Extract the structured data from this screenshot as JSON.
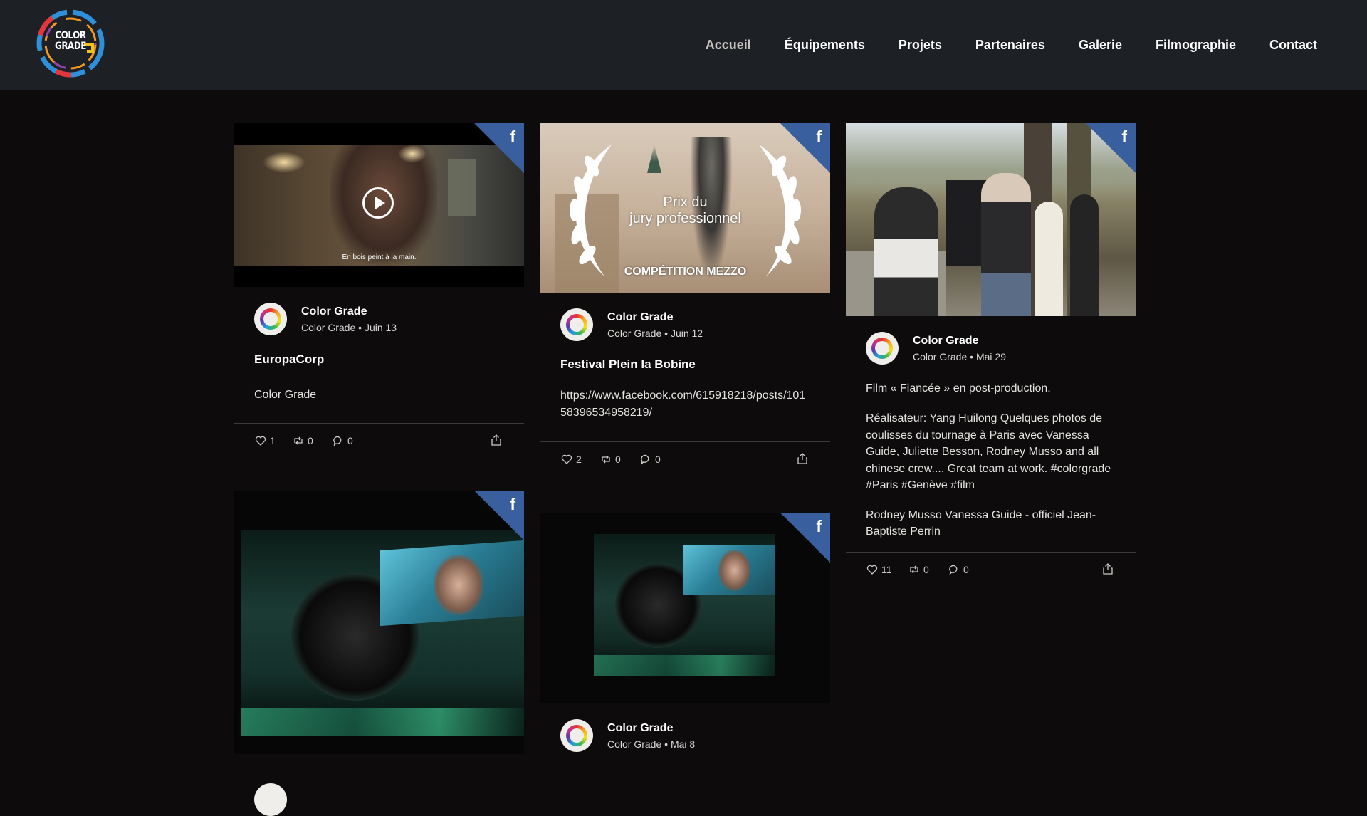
{
  "site": {
    "logo_text": "COLOR\nGRADE",
    "nav": [
      {
        "label": "Accueil",
        "active": true
      },
      {
        "label": "Équipements"
      },
      {
        "label": "Projets"
      },
      {
        "label": "Partenaires"
      },
      {
        "label": "Galerie"
      },
      {
        "label": "Filmographie"
      },
      {
        "label": "Contact"
      }
    ]
  },
  "posts": [
    {
      "source": "f",
      "media_caption": "En bois peint à la main.",
      "author": "Color Grade",
      "account": "Color Grade",
      "date": "Juin 13",
      "title": "EuropaCorp",
      "body": [
        "Color Grade"
      ],
      "likes": "1",
      "shares": "0",
      "comments": "0"
    },
    {
      "source": "f",
      "media_title_line1": "Prix du",
      "media_title_line2": "jury professionnel",
      "media_subtitle": "COMPÉTITION MEZZO",
      "author": "Color Grade",
      "account": "Color Grade",
      "date": "Juin 12",
      "title": "Festival Plein la Bobine",
      "body": [
        "https://www.facebook.com/615918218/posts/10158396534958219/"
      ],
      "likes": "2",
      "shares": "0",
      "comments": "0"
    },
    {
      "source": "f",
      "author": "Color Grade",
      "account": "Color Grade",
      "date": "Mai 29",
      "body": [
        "Film « Fiancée » en post-production.",
        "Réalisateur: Yang Huilong Quelques photos de coulisses du tournage à Paris avec Vanessa Guide, Juliette Besson, Rodney Musso and all chinese crew.... Great team at work. #colorgrade #Paris #Genève #film",
        "Rodney Musso Vanessa Guide - officiel Jean-Baptiste Perrin"
      ],
      "likes": "11",
      "shares": "0",
      "comments": "0"
    },
    {
      "source": "f"
    },
    {
      "source": "f",
      "author": "Color Grade",
      "account": "Color Grade",
      "date": "Mai 8"
    }
  ],
  "colors": {
    "header_bg": "#1d2025",
    "page_bg": "#0d0b0c",
    "facebook_blue": "#3a5f9f",
    "active_nav": "#c8c3bd"
  }
}
